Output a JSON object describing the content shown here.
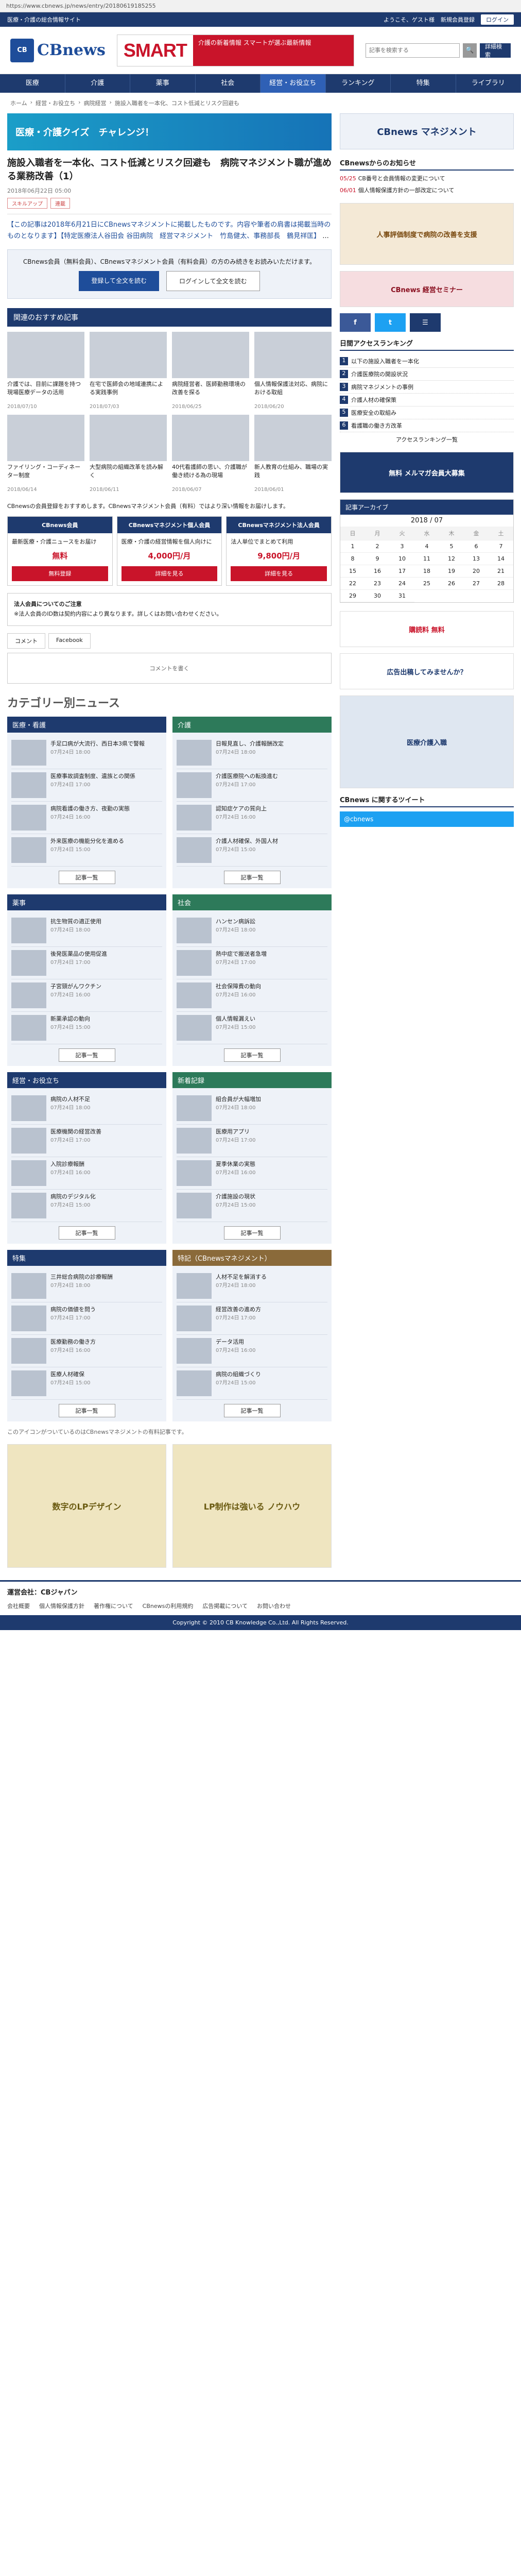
{
  "browser": {
    "url": "https://www.cbnews.jp/news/entry/20180619185255"
  },
  "topbar": {
    "text": "医療・介護の総合情報サイト",
    "links": [
      "ようこそ、ゲスト様",
      "新規会員登録"
    ],
    "login": "ログイン"
  },
  "header": {
    "logo_mark": "CB",
    "logo_text": "CBnews",
    "banner_word": "SMART",
    "banner_copy": "介護の新着情報 スマートが選ぶ最新情報",
    "search_placeholder": "記事を検索する",
    "detail_search": "詳細検索"
  },
  "nav": [
    "医療",
    "介護",
    "薬事",
    "社会",
    "経営・お役立ち",
    "ランキング",
    "特集",
    "ライブラリ"
  ],
  "breadcrumb": [
    "ホーム",
    "経営・お役立ち",
    "病院経営",
    "施設入職者を一本化、コスト低減とリスク回避も"
  ],
  "banner_wide": "医療・介護クイズ　チャレンジ！",
  "article": {
    "title": "施設入職者を一本化、コスト低減とリスク回避も　病院マネジメント職が進める業務改善（1）",
    "date": "2018年06月22日 05:00",
    "tags": [
      "スキルアップ",
      "連載"
    ],
    "lead": "【この記事は2018年6月21日にCBnewsマネジメントに掲載したものです。内容や筆者の肩書は掲載当時のものとなります】【特定医療法人谷田会 谷田病院　経営マネジメント　竹島健太、事務部長　鶴見祥匡】",
    "lead_more": "...",
    "member_text": "CBnews会員（無料会員）、CBnewsマネジメント会員（有料会員）の方のみ続きをお読みいただけます。",
    "register_btn": "登録して全文を読む",
    "login_btn": "ログインして全文を読む"
  },
  "recommend": {
    "heading": "関連のおすすめ記事",
    "items": [
      {
        "title": "介護では、目前に課題を持つ現場医療データの活用",
        "date": "2018/07/10"
      },
      {
        "title": "在宅で医師会の地域連携による実践事例",
        "date": "2018/07/03"
      },
      {
        "title": "病院経営者、医師勤務環境の改善を探る",
        "date": "2018/06/25"
      },
      {
        "title": "個人情報保護法対応、病院における取組",
        "date": "2018/06/20"
      },
      {
        "title": "ファイリング・コーディネーター制度",
        "date": "2018/06/14"
      },
      {
        "title": "大型病院の組織改革を読み解く",
        "date": "2018/06/11"
      },
      {
        "title": "40代看護師の思い、介護職が働き続ける為の現場",
        "date": "2018/06/07"
      },
      {
        "title": "新人教育の仕組み、職場の実践",
        "date": "2018/06/01"
      }
    ]
  },
  "plans": {
    "intro": "CBnewsの会員登録をおすすめします。CBnewsマネジメント会員（有料）ではより深い情報をお届けします。",
    "list": [
      {
        "name": "CBnews会員",
        "desc": "最新医療・介護ニュースをお届け",
        "price": "無料",
        "btn": "無料登録"
      },
      {
        "name": "CBnewsマネジメント個人会員",
        "desc": "医療・介護の経営情報を個人向けに",
        "price": "4,000円/月",
        "btn": "詳細を見る"
      },
      {
        "name": "CBnewsマネジメント法人会員",
        "desc": "法人単位でまとめて利用",
        "price": "9,800円/月",
        "btn": "詳細を見る"
      }
    ]
  },
  "note": {
    "title": "法人会員についてのご注意",
    "text": "※法人会員のID数は契約内容により異なります。詳しくはお問い合わせください。"
  },
  "comments": {
    "tabs": [
      "コメント",
      "Facebook"
    ],
    "placeholder": "コメントを書く"
  },
  "categories": {
    "title": "カテゴリー別ニュース",
    "blocks": [
      {
        "name": "医療・看護",
        "color": "blue",
        "items": [
          {
            "title": "手足口病が大流行、西日本3県で警報",
            "date": "07月24日 18:00"
          },
          {
            "title": "医療事故調査制度、遺族との関係",
            "date": "07月24日 17:00"
          },
          {
            "title": "病院看護の働き方、夜勤の実態",
            "date": "07月24日 16:00"
          },
          {
            "title": "外来医療の機能分化を進める",
            "date": "07月24日 15:00"
          }
        ]
      },
      {
        "name": "介護",
        "color": "teal",
        "items": [
          {
            "title": "日報見直し、介護報酬改定",
            "date": "07月24日 18:00"
          },
          {
            "title": "介護医療院への転換進む",
            "date": "07月24日 17:00"
          },
          {
            "title": "認知症ケアの質向上",
            "date": "07月24日 16:00"
          },
          {
            "title": "介護人材確保、外国人材",
            "date": "07月24日 15:00"
          }
        ]
      },
      {
        "name": "薬事",
        "color": "blue",
        "items": [
          {
            "title": "抗生物質の適正使用",
            "date": "07月24日 18:00"
          },
          {
            "title": "後発医薬品の使用促進",
            "date": "07月24日 17:00"
          },
          {
            "title": "子宮頸がんワクチン",
            "date": "07月24日 16:00"
          },
          {
            "title": "新薬承認の動向",
            "date": "07月24日 15:00"
          }
        ]
      },
      {
        "name": "社会",
        "color": "teal",
        "items": [
          {
            "title": "ハンセン病訴訟",
            "date": "07月24日 18:00"
          },
          {
            "title": "熱中症で搬送者急増",
            "date": "07月24日 17:00"
          },
          {
            "title": "社会保障費の動向",
            "date": "07月24日 16:00"
          },
          {
            "title": "個人情報漏えい",
            "date": "07月24日 15:00"
          }
        ]
      },
      {
        "name": "経営・お役立ち",
        "color": "blue",
        "items": [
          {
            "title": "病院の人材不足",
            "date": "07月24日 18:00"
          },
          {
            "title": "医療機関の経営改善",
            "date": "07月24日 17:00"
          },
          {
            "title": "入院診療報酬",
            "date": "07月24日 16:00"
          },
          {
            "title": "病院のデジタル化",
            "date": "07月24日 15:00"
          }
        ]
      },
      {
        "name": "新着記録",
        "color": "teal",
        "items": [
          {
            "title": "組合員が大幅増加",
            "date": "07月24日 18:00"
          },
          {
            "title": "医療用アプリ",
            "date": "07月24日 17:00"
          },
          {
            "title": "夏季休業の実態",
            "date": "07月24日 16:00"
          },
          {
            "title": "介護施設の現状",
            "date": "07月24日 15:00"
          }
        ]
      },
      {
        "name": "特集",
        "color": "blue",
        "items": [
          {
            "title": "三井総合病院の診療報酬",
            "date": "07月24日 18:00"
          },
          {
            "title": "病院の価値を問う",
            "date": "07月24日 17:00"
          },
          {
            "title": "医療勤務の働き方",
            "date": "07月24日 16:00"
          },
          {
            "title": "医療人材確保",
            "date": "07月24日 15:00"
          }
        ]
      },
      {
        "name": "特記（CBnewsマネジメント）",
        "color": "brown",
        "items": [
          {
            "title": "人材不足を解消する",
            "date": "07月24日 18:00"
          },
          {
            "title": "経営改善の進め方",
            "date": "07月24日 17:00"
          },
          {
            "title": "データ活用",
            "date": "07月24日 16:00"
          },
          {
            "title": "病院の組織づくり",
            "date": "07月24日 15:00"
          }
        ]
      }
    ],
    "more": "記事一覧"
  },
  "bottom_note": "このアイコンがついているのはCBnewsマネジメントの有料記事です。",
  "bottom_ads": [
    "数字のLPデザイン",
    "LP制作は強いる ノウハウ"
  ],
  "sidebar": {
    "notice_title": "CBnewsからのお知らせ",
    "notices": [
      {
        "date": "05/25",
        "text": "CB番号と会員情報の変更について"
      },
      {
        "date": "06/01",
        "text": "個人情報保護方針の一部改定について"
      }
    ],
    "ad1": "人事評価制度で病院の改善を支援",
    "ad2": "CBnews 経営セミナー",
    "ranking_title": "日間アクセスランキング",
    "ranking": [
      "以下の施設入職者を一本化",
      "介護医療院の開設状況",
      "病院マネジメントの事例",
      "介護人材の確保策",
      "医療安全の取組み",
      "看護職の働き方改革"
    ],
    "ranking_more": "アクセスランキング一覧",
    "management_banner": "CBnews マネジメント",
    "magazine": "無料 メルマガ会員大募集",
    "calendar": {
      "title": "記事アーカイブ",
      "month": "2018 / 07",
      "weekdays": [
        "日",
        "月",
        "火",
        "水",
        "木",
        "金",
        "土"
      ],
      "days": [
        "1",
        "2",
        "3",
        "4",
        "5",
        "6",
        "7",
        "8",
        "9",
        "10",
        "11",
        "12",
        "13",
        "14",
        "15",
        "16",
        "17",
        "18",
        "19",
        "20",
        "21",
        "22",
        "23",
        "24",
        "25",
        "26",
        "27",
        "28",
        "29",
        "30",
        "31"
      ]
    },
    "banner_free": "購読料 無料",
    "banner_cbnews": "広告出稿してみませんか？",
    "banner_book": "医療介護入職",
    "twitter": "CBnews に関するツイート",
    "twitter_handle": "@cbnews"
  },
  "footer": {
    "company": "運営会社：CBジャパン",
    "links": [
      "会社概要",
      "個人情報保護方針",
      "著作権について",
      "CBnewsの利用規約",
      "広告掲載について",
      "お問い合わせ"
    ],
    "copyright": "Copyright © 2010 CB Knowledge Co.,Ltd. All Rights Reserved."
  },
  "colors": {
    "navy": "#1e3a6e",
    "red": "#c9142a"
  }
}
